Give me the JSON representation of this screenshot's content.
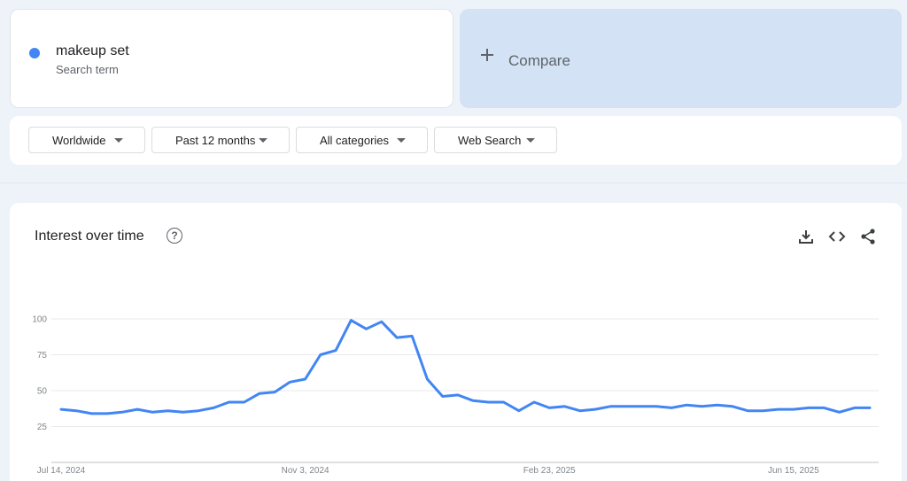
{
  "term": {
    "name": "makeup set",
    "type": "Search term",
    "color": "#4285f4"
  },
  "compare": {
    "label": "Compare"
  },
  "filters": [
    "Worldwide",
    "Past 12 months",
    "All categories",
    "Web Search"
  ],
  "card": {
    "title": "Interest over time"
  },
  "chart_data": {
    "type": "line",
    "title": "Interest over time",
    "ylim": [
      0,
      100
    ],
    "yticks": [
      "25",
      "50",
      "75",
      "100"
    ],
    "xtick_labels": [
      "Jul 14, 2024",
      "Nov 3, 2024",
      "Feb 23, 2025",
      "Jun 15, 2025"
    ],
    "grid": true,
    "series": [
      {
        "color": "#4285f4",
        "values": [
          37,
          36,
          34,
          34,
          35,
          37,
          35,
          36,
          35,
          36,
          38,
          42,
          42,
          48,
          49,
          56,
          58,
          75,
          78,
          99,
          93,
          98,
          87,
          88,
          58,
          46,
          47,
          43,
          42,
          42,
          36,
          42,
          38,
          39,
          36,
          37,
          39,
          39,
          39,
          39,
          38,
          40,
          39,
          40,
          39,
          36,
          36,
          37,
          37,
          38,
          38,
          35,
          38,
          38
        ]
      }
    ]
  }
}
